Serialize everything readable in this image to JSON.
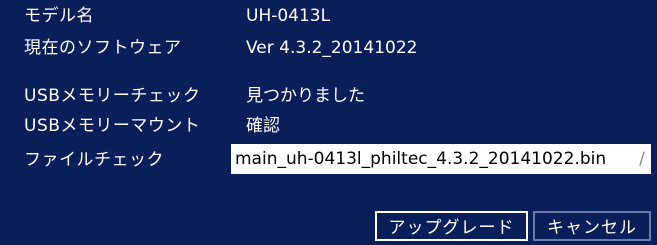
{
  "rows": {
    "model": {
      "label": "モデル名",
      "value": "UH-0413L"
    },
    "software": {
      "label": "現在のソフトウェア",
      "value": "Ver 4.3.2_20141022"
    },
    "usb_check": {
      "label": "USBメモリーチェック",
      "value": "見つかりました"
    },
    "usb_mount": {
      "label": "USBメモリーマウント",
      "value": "確認"
    },
    "file_check": {
      "label": "ファイルチェック",
      "value": "main_uh-0413l_philtec_4.3.2_20141022.bin"
    }
  },
  "buttons": {
    "upgrade_label": "アップグレード",
    "cancel_label": "キャンセル"
  },
  "colors": {
    "background": "#0a1f5a",
    "text": "#ffffff",
    "field": "#ffffff"
  }
}
